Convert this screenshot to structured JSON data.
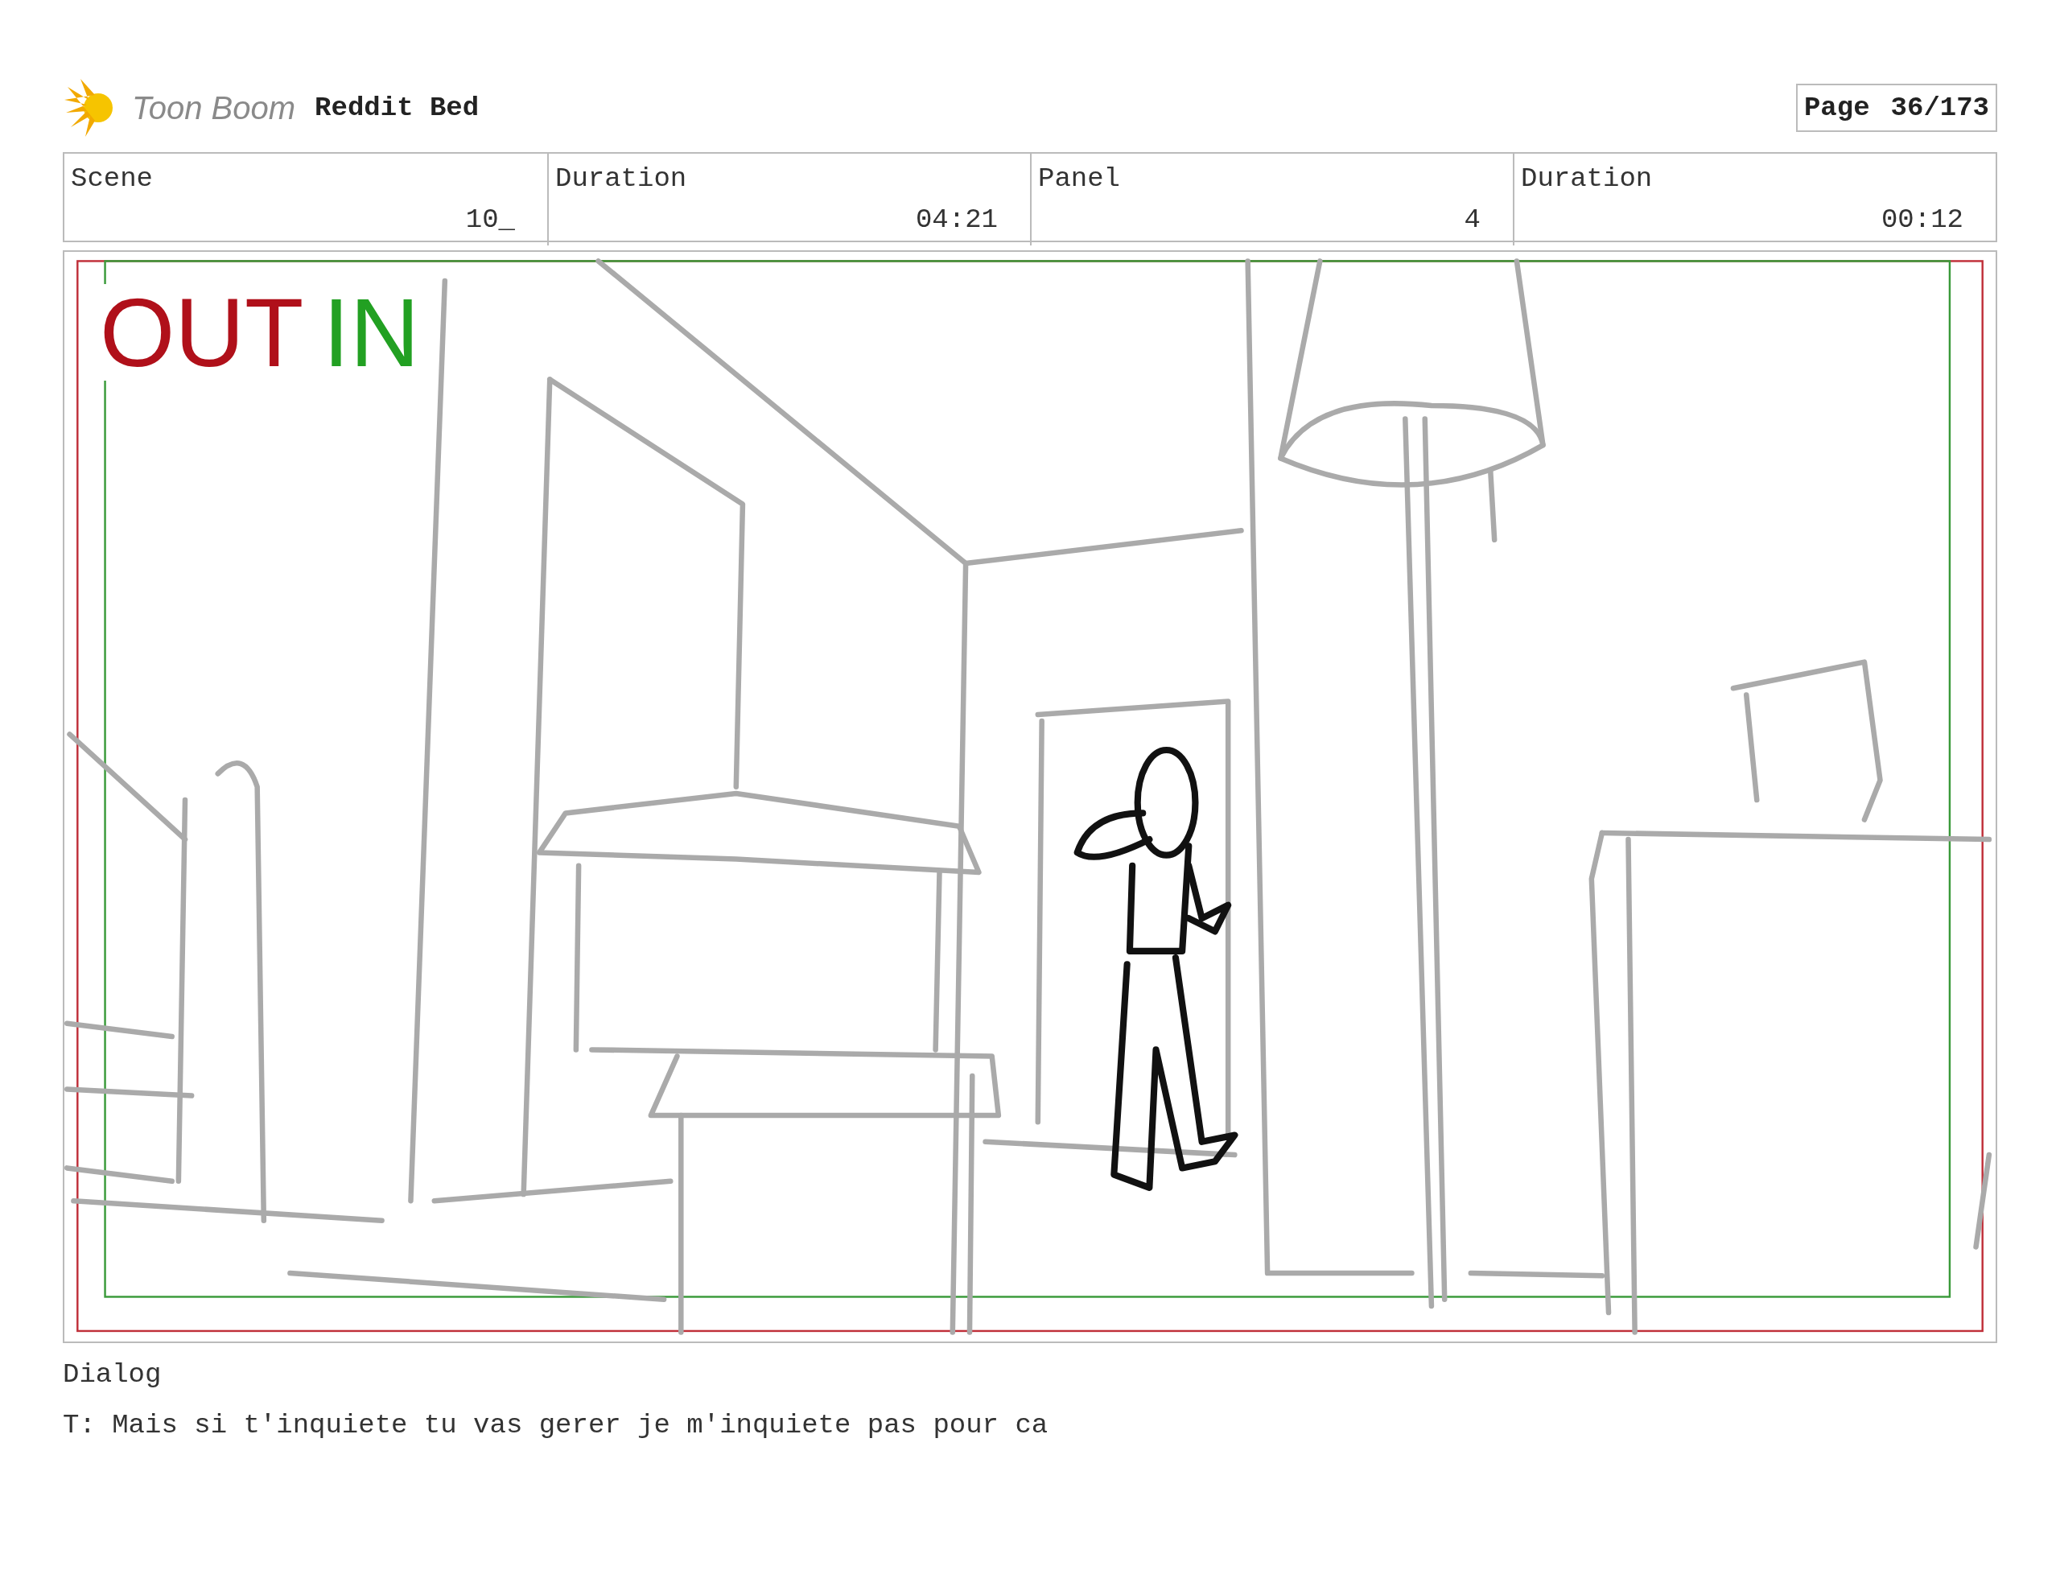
{
  "header": {
    "logo": "Toon Boom",
    "title": "Reddit Bed",
    "page_label": "Page",
    "page_number": "36/173"
  },
  "info": [
    {
      "label": "Scene",
      "value": "10_"
    },
    {
      "label": "Duration",
      "value": "04:21"
    },
    {
      "label": "Panel",
      "value": "4"
    },
    {
      "label": "Duration",
      "value": "00:12"
    }
  ],
  "panel": {
    "overlay_out": "OUT",
    "overlay_in": "IN"
  },
  "dialog": {
    "label": "Dialog",
    "text": "T: Mais si t'inquiete tu vas gerer je m'inquiete pas pour ca"
  }
}
